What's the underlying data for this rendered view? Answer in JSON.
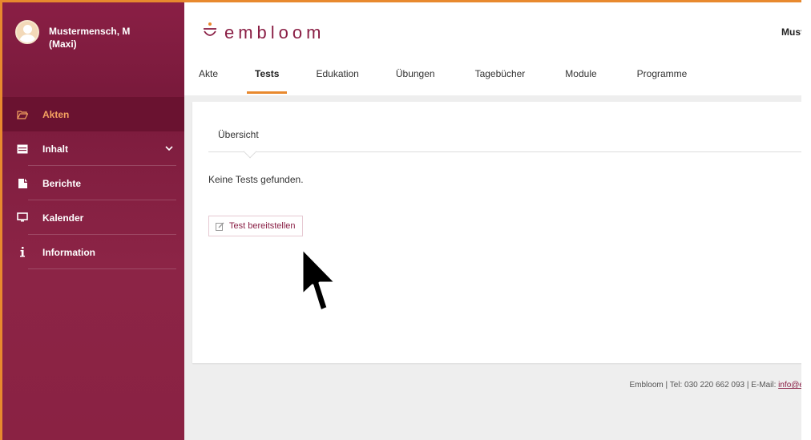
{
  "user": {
    "name_line1": "Mustermensch, M",
    "name_line2": "(Maxi)"
  },
  "sidebar": {
    "items": [
      {
        "label": "Akten",
        "icon": "folder-open-icon",
        "active": true
      },
      {
        "label": "Inhalt",
        "icon": "list-icon",
        "has_submenu": true
      },
      {
        "label": "Berichte",
        "icon": "report-icon"
      },
      {
        "label": "Kalender",
        "icon": "monitor-icon"
      },
      {
        "label": "Information",
        "icon": "info-icon"
      }
    ]
  },
  "header": {
    "logo_text": "embloom",
    "user_short": "Must",
    "tabs": [
      "Akte",
      "Tests",
      "Edukation",
      "Übungen",
      "Tagebücher",
      "Module",
      "Programme"
    ],
    "active_tab": "Tests"
  },
  "main": {
    "subtab": "Übersicht",
    "empty_message": "Keine Tests gefunden.",
    "deploy_button": "Test bereitstellen"
  },
  "footer": {
    "text": "Embloom | Tel: 030 220 662 093 | E-Mail: ",
    "email": "info@e"
  },
  "colors": {
    "brand": "#8a1f45",
    "accent": "#e8892e",
    "active_nav_text": "#f4a261"
  }
}
